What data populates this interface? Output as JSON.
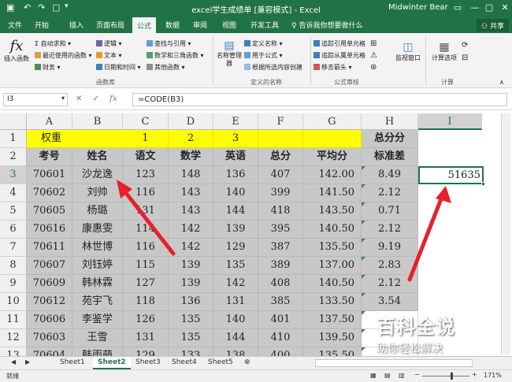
{
  "window": {
    "title": "excel学生成绩单 [兼容模式] - Excel",
    "user": "Midwinter Bear",
    "share_label": "共享"
  },
  "ribbon_tabs": [
    "文件",
    "开始",
    "插入",
    "页面布局",
    "公式",
    "数据",
    "审阅",
    "视图",
    "开发工具"
  ],
  "tell_me": "告诉我你想要做什么",
  "ribbon": {
    "insert_function": "插入函数",
    "autosum": "自动求和",
    "recent": "最近使用的函数",
    "financial": "财务",
    "logical": "逻辑",
    "text": "文本",
    "datetime": "日期和时间",
    "lookup": "查找与引用",
    "math": "数学和三角函数",
    "other": "其他函数",
    "group_library": "函数库",
    "name_manager": "名称管理器",
    "define_name": "定义名称",
    "use_in_formula": "用于公式",
    "create_from_selection": "根据所选内容创建",
    "group_names": "定义的名称",
    "trace_precedents": "追踪引用单元格",
    "trace_dependents": "追踪从属单元格",
    "remove_arrows": "移去箭头",
    "group_audit": "公式审核",
    "watch_window": "监视窗口",
    "calc_options": "计算选项",
    "group_calc": "计算"
  },
  "formula_bar": {
    "name_box": "I3",
    "formula": "=CODE(B3)"
  },
  "columns": [
    "A",
    "B",
    "C",
    "D",
    "E",
    "F",
    "G",
    "H",
    "I"
  ],
  "rows": [
    "1",
    "2",
    "3",
    "4",
    "5",
    "6",
    "7",
    "8",
    "9",
    "10",
    "11",
    "12",
    "13"
  ],
  "row1": {
    "a": "权重",
    "c": "1",
    "d": "2",
    "e": "3",
    "h": "总分分"
  },
  "headers": [
    "考号",
    "姓名",
    "语文",
    "数学",
    "英语",
    "总分",
    "平均分",
    "标准差"
  ],
  "data": [
    [
      "70601",
      "沙龙逸",
      "123",
      "148",
      "136",
      "407",
      "142.00",
      "8.49"
    ],
    [
      "70602",
      "刘帅",
      "116",
      "143",
      "140",
      "399",
      "141.50",
      "2.12"
    ],
    [
      "70605",
      "杨璐",
      "131",
      "143",
      "144",
      "418",
      "143.50",
      "0.71"
    ],
    [
      "70616",
      "康惠雯",
      "114",
      "142",
      "139",
      "395",
      "140.50",
      "2.12"
    ],
    [
      "70611",
      "林世博",
      "116",
      "142",
      "129",
      "387",
      "135.50",
      "9.19"
    ],
    [
      "70607",
      "刘钰婷",
      "115",
      "139",
      "135",
      "389",
      "137.00",
      "2.83"
    ],
    [
      "70609",
      "韩林霖",
      "127",
      "139",
      "142",
      "408",
      "140.50",
      "2.12"
    ],
    [
      "70612",
      "苑宇飞",
      "118",
      "136",
      "131",
      "385",
      "133.50",
      "3.54"
    ],
    [
      "70606",
      "李鉴学",
      "126",
      "135",
      "140",
      "401",
      "137.50",
      ""
    ],
    [
      "70603",
      "王雪",
      "131",
      "135",
      "144",
      "410",
      "139.50",
      ""
    ],
    [
      "70604",
      "韩雨萌",
      "129",
      "133",
      "138",
      "400",
      "135.50",
      ""
    ]
  ],
  "active_cell_value": "51635",
  "sheets": [
    "Sheet1",
    "Sheet2",
    "Sheet3",
    "Sheet4",
    "Sheet5"
  ],
  "active_sheet": "Sheet2",
  "status": {
    "ready": "就绪",
    "zoom": "171%"
  },
  "watermark": {
    "brand": "百科全说",
    "slogan": "助你轻松解决"
  },
  "colors": {
    "excel_green": "#217346",
    "highlight_yellow": "#ffff00",
    "arrow_red": "#e8202a"
  }
}
